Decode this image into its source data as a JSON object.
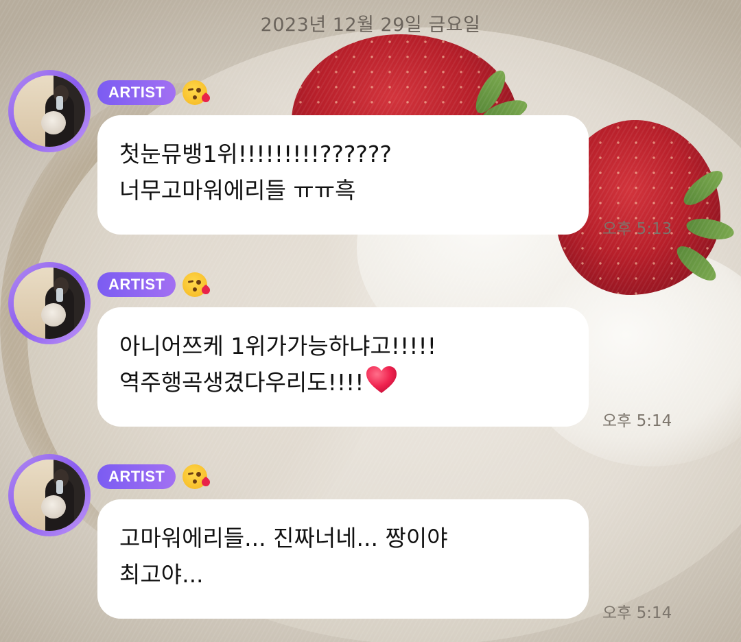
{
  "date_header": "2023년 12월 29일 금요일",
  "messages": [
    {
      "badge": "ARTIST",
      "badge_emoji": "face-blowing-a-kiss-icon",
      "lines": [
        "첫눈뮤뱅1위!!!!!!!!!??????",
        "너무고마워에리들 ㅠㅠ흑"
      ],
      "time": "오후 5:13"
    },
    {
      "badge": "ARTIST",
      "badge_emoji": "face-blowing-a-kiss-icon",
      "lines": [
        "아니어쯔케 1위가가능하냐고!!!!!",
        "역주행곡생겼다우리도!!!!"
      ],
      "trailing_emoji": "red-heart-icon",
      "time": "오후 5:14"
    },
    {
      "badge": "ARTIST",
      "badge_emoji": "face-blowing-a-kiss-icon",
      "lines": [
        "고마워에리들... 진짜너네... 짱이야",
        "최고야..."
      ],
      "time": "오후 5:14"
    }
  ],
  "colors": {
    "badge_gradient_start": "#7b5cf2",
    "badge_gradient_end": "#a270f2",
    "bubble": "#ffffff",
    "text": "#111111",
    "meta_text": "#7c756c"
  }
}
